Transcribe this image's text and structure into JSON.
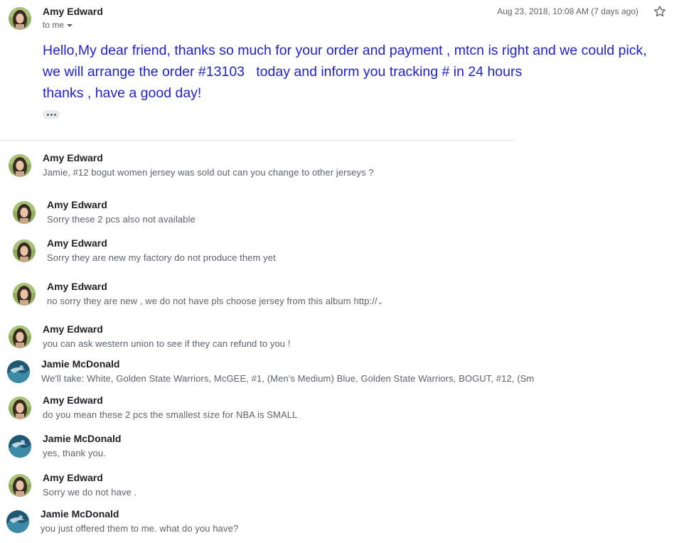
{
  "expanded": {
    "sender": "Amy Edward",
    "to": "to me",
    "date": "Aug 23, 2018, 10:08 AM (7 days ago)",
    "body_lines": [
      "Hello,My dear friend, thanks so much for your order and payment , mtcn is right and we could pick,",
      "we will arrange the order #13103   today and inform you tracking # in 24 hours",
      "thanks , have a good day!"
    ]
  },
  "messages": [
    {
      "sender": "Amy Edward",
      "snippet": "Jamie, #12 bogut women jersey was sold out can you change to other jerseys ?",
      "avatar": "amy"
    },
    {
      "sender": "Amy Edward",
      "snippet": "Sorry these 2 pcs also not available",
      "avatar": "amy"
    },
    {
      "sender": "Amy Edward",
      "snippet": "Sorry they are new my factory do not produce them yet",
      "avatar": "amy"
    },
    {
      "sender": "Amy Edward",
      "snippet": "no sorry they are new , we do not have pls choose jersey from this album http://",
      "avatar": "amy"
    },
    {
      "sender": "Amy Edward",
      "snippet": "you can ask western union to see if they can refund to you !",
      "avatar": "amy"
    },
    {
      "sender": "Jamie McDonald",
      "snippet": "We'll take: White, Golden State Warriors, McGEE, #1, (Men's Medium) Blue, Golden State Warriors, BOGUT, #12, (Sm",
      "avatar": "jamie"
    },
    {
      "sender": "Amy Edward",
      "snippet": "do you mean these 2 pcs the smallest size for NBA is SMALL",
      "avatar": "amy"
    },
    {
      "sender": "Jamie McDonald",
      "snippet": "yes, thank you.",
      "avatar": "jamie"
    },
    {
      "sender": "Amy Edward",
      "snippet": "Sorry we do not have .",
      "avatar": "amy"
    },
    {
      "sender": "Jamie McDonald",
      "snippet": "you just offered them to me. what do you have?",
      "avatar": "jamie"
    }
  ],
  "icons": {
    "star": "star-outline-icon",
    "expand_caret": "caret-down-icon",
    "ellipsis": "more-horiz-icon"
  },
  "colors": {
    "body_text": "#2222cc",
    "snippet_text": "#5f6368",
    "divider": "#e0e0e0"
  }
}
